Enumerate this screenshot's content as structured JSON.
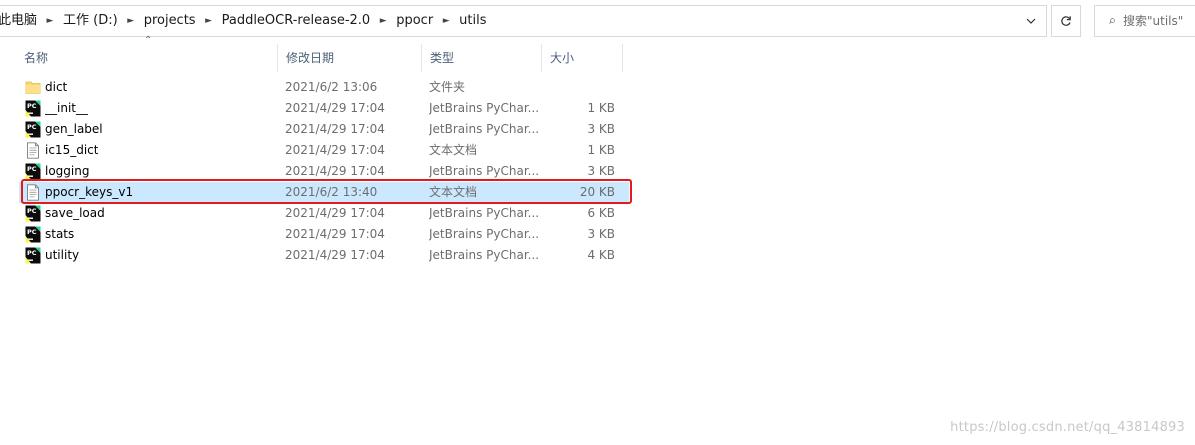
{
  "address_bar": {
    "crumbs": [
      "此电脑",
      "工作 (D:)",
      "projects",
      "PaddleOCR-release-2.0",
      "ppocr",
      "utils"
    ]
  },
  "search": {
    "placeholder": "搜索\"utils\""
  },
  "columns": {
    "name": "名称",
    "date": "修改日期",
    "type": "类型",
    "size": "大小"
  },
  "files": [
    {
      "name": "dict",
      "date": "2021/6/2 13:06",
      "type": "文件夹",
      "size": "",
      "icon": "folder-icon",
      "selected": false
    },
    {
      "name": "__init__",
      "date": "2021/4/29 17:04",
      "type": "JetBrains PyChar...",
      "size": "1 KB",
      "icon": "pycharm-icon",
      "selected": false
    },
    {
      "name": "gen_label",
      "date": "2021/4/29 17:04",
      "type": "JetBrains PyChar...",
      "size": "3 KB",
      "icon": "pycharm-icon",
      "selected": false
    },
    {
      "name": "ic15_dict",
      "date": "2021/4/29 17:04",
      "type": "文本文档",
      "size": "1 KB",
      "icon": "text-file-icon",
      "selected": false
    },
    {
      "name": "logging",
      "date": "2021/4/29 17:04",
      "type": "JetBrains PyChar...",
      "size": "3 KB",
      "icon": "pycharm-icon",
      "selected": false
    },
    {
      "name": "ppocr_keys_v1",
      "date": "2021/6/2 13:40",
      "type": "文本文档",
      "size": "20 KB",
      "icon": "text-file-icon",
      "selected": true
    },
    {
      "name": "save_load",
      "date": "2021/4/29 17:04",
      "type": "JetBrains PyChar...",
      "size": "6 KB",
      "icon": "pycharm-icon",
      "selected": false
    },
    {
      "name": "stats",
      "date": "2021/4/29 17:04",
      "type": "JetBrains PyChar...",
      "size": "3 KB",
      "icon": "pycharm-icon",
      "selected": false
    },
    {
      "name": "utility",
      "date": "2021/4/29 17:04",
      "type": "JetBrains PyChar...",
      "size": "4 KB",
      "icon": "pycharm-icon",
      "selected": false
    }
  ],
  "watermark": "https://blog.csdn.net/qq_43814893",
  "colors": {
    "selection": "#cce8ff",
    "highlight_border": "#e01b1b",
    "header_text": "#4c607a",
    "folder": "#f8d775"
  }
}
